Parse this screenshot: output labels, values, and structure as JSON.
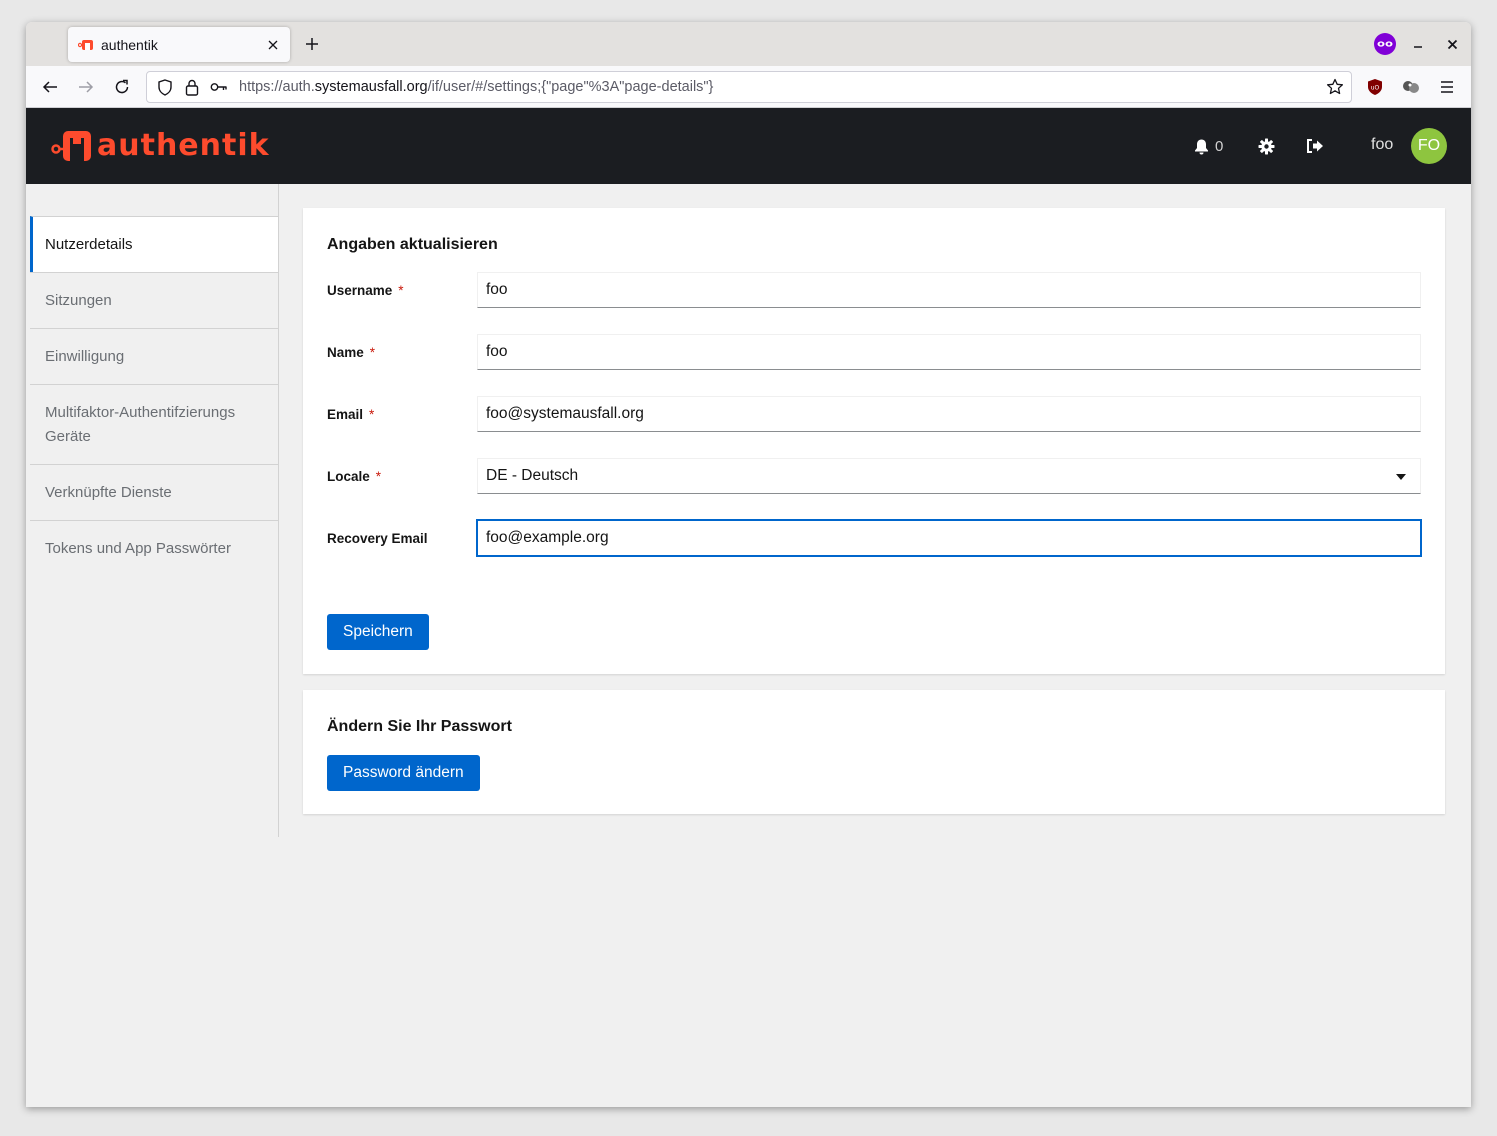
{
  "browser": {
    "tab_title": "authentik",
    "url_prefix": "https://auth.",
    "url_domain": "systemausfall.org",
    "url_path": "/if/user/#/settings;{\"page\"%3A\"page-details\"}"
  },
  "header": {
    "brand": "authentik",
    "notification_count": "0",
    "username": "foo",
    "avatar_initials": "FO",
    "avatar_color": "#8ec53f",
    "brand_color": "#fd4b2d"
  },
  "sidebar": {
    "items": [
      {
        "label": "Nutzerdetails",
        "active": true
      },
      {
        "label": "Sitzungen"
      },
      {
        "label": "Einwilligung"
      },
      {
        "label": "Multifaktor-Authentifzierungs Geräte"
      },
      {
        "label": "Verknüpfte Dienste"
      },
      {
        "label": "Tokens und App Passwörter"
      }
    ]
  },
  "details_form": {
    "title": "Angaben aktualisieren",
    "fields": [
      {
        "label": "Username",
        "required_mark": "*",
        "value": "foo"
      },
      {
        "label": "Name",
        "required_mark": "*",
        "value": "foo"
      },
      {
        "label": "Email",
        "required_mark": "*",
        "value": "foo@systemausfall.org"
      },
      {
        "label": "Locale",
        "required_mark": "*",
        "value": "DE - Deutsch"
      },
      {
        "label": "Recovery Email",
        "value": "foo@example.org"
      }
    ],
    "save_label": "Speichern"
  },
  "password_card": {
    "title": "Ändern Sie Ihr Passwort",
    "button_label": "Password ändern"
  },
  "colors": {
    "primary": "#0066cc",
    "header_bg": "#1b1d21",
    "required": "#c9190b"
  }
}
